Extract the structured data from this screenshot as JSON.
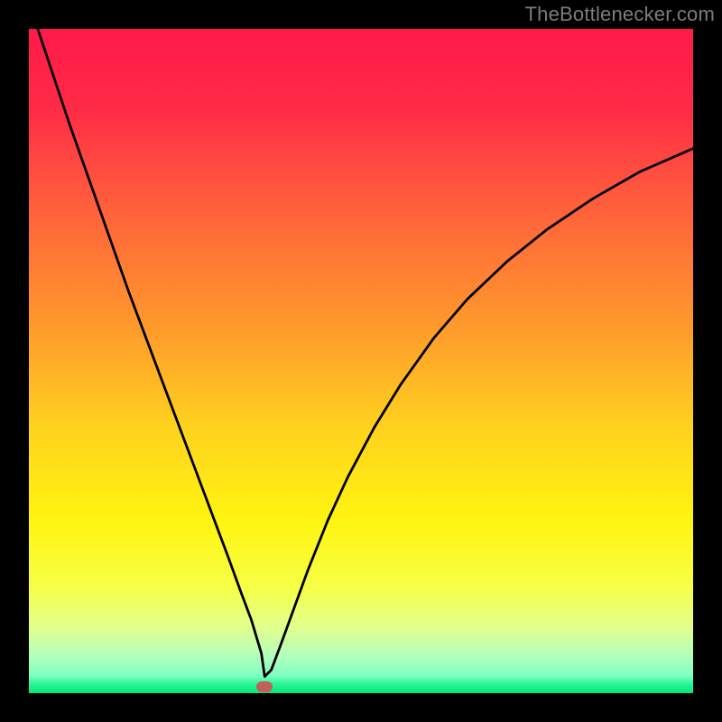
{
  "watermark": {
    "text": "TheBottlenecker.com"
  },
  "colors": {
    "gradient_stops": [
      {
        "offset": 0.0,
        "color": "#ff1a4a"
      },
      {
        "offset": 0.12,
        "color": "#ff2b47"
      },
      {
        "offset": 0.28,
        "color": "#ff643a"
      },
      {
        "offset": 0.45,
        "color": "#ff9a2c"
      },
      {
        "offset": 0.6,
        "color": "#ffd21e"
      },
      {
        "offset": 0.74,
        "color": "#fff410"
      },
      {
        "offset": 0.84,
        "color": "#f6ff46"
      },
      {
        "offset": 0.9,
        "color": "#e2ff8c"
      },
      {
        "offset": 0.94,
        "color": "#b8ffb8"
      },
      {
        "offset": 0.974,
        "color": "#80ffc4"
      },
      {
        "offset": 0.985,
        "color": "#30f59c"
      },
      {
        "offset": 1.0,
        "color": "#00e878"
      }
    ],
    "frame": "#000000",
    "curve": "#000000",
    "marker": "#c06058"
  },
  "chart_data": {
    "type": "line",
    "title": "",
    "xlabel": "",
    "ylabel": "",
    "xlim": [
      0,
      100
    ],
    "ylim": [
      0,
      100
    ],
    "grid": false,
    "legend": false,
    "marker": {
      "x": 35.5,
      "y": 1.0
    },
    "series": [
      {
        "name": "bottleneck-curve",
        "x": [
          0,
          3,
          6,
          9,
          12,
          15,
          18,
          21,
          24,
          27,
          30,
          32,
          33.5,
          35,
          35.5,
          36.5,
          38,
          40,
          42,
          45,
          48,
          52,
          56,
          61,
          66,
          72,
          78,
          85,
          92,
          100
        ],
        "y": [
          104,
          95,
          86,
          77.5,
          69,
          60.5,
          52.5,
          44.5,
          36.5,
          28.5,
          20.5,
          15,
          11,
          6,
          2.5,
          3.5,
          7.5,
          13,
          18.5,
          26,
          32.5,
          40,
          46.5,
          53.5,
          59.3,
          65,
          69.8,
          74.5,
          78.5,
          82
        ]
      }
    ]
  }
}
